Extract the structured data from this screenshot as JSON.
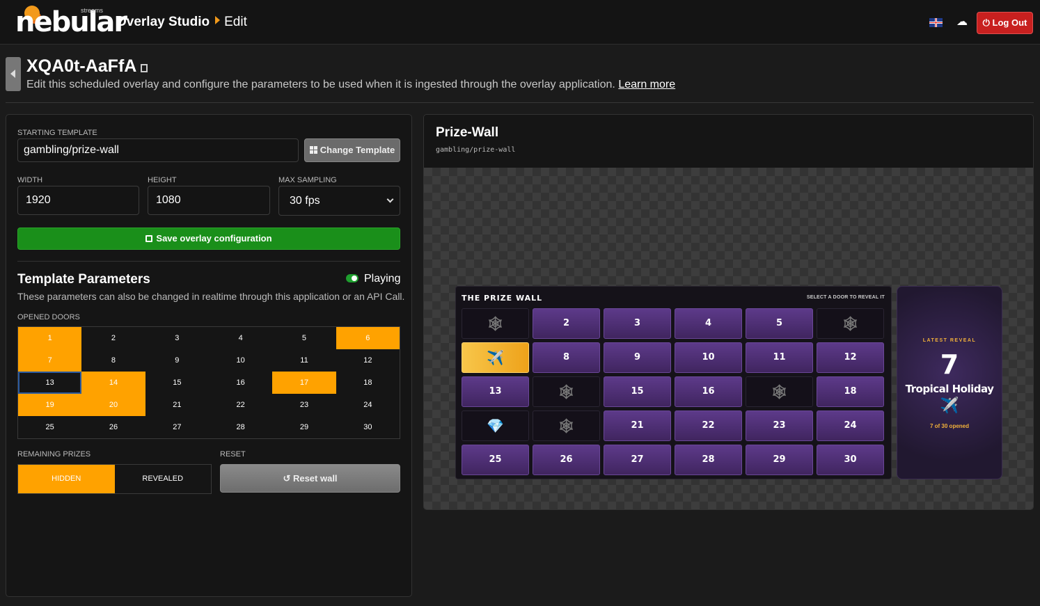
{
  "app": {
    "logo_text": "nebular",
    "logo_sub": "streams",
    "breadcrumb": [
      "Overlay Studio",
      "Edit"
    ],
    "language_flag": "uk-flag-icon",
    "logout_label": "Log Out",
    "colors": {
      "accent": "#f29a1b",
      "logout": "#c8201f",
      "save": "#1a8f1a",
      "door_open": "#ffa200"
    }
  },
  "header": {
    "overlay_id": "XQA0t-AaFfA",
    "description": "Edit this scheduled overlay and configure the parameters to be used when it is ingested through the overlay application.",
    "learn_more": "Learn more"
  },
  "config": {
    "template_label": "STARTING TEMPLATE",
    "template_value": "gambling/prize-wall",
    "change_template_label": "Change Template",
    "width_label": "WIDTH",
    "width_value": "1920",
    "height_label": "HEIGHT",
    "height_value": "1080",
    "sampling_label": "MAX SAMPLING",
    "sampling_value": "30 fps",
    "save_label": "Save overlay configuration"
  },
  "params": {
    "title": "Template Parameters",
    "playing_label": "Playing",
    "description": "These parameters can also be changed in realtime through this application or an API Call.",
    "doors_label": "OPENED DOORS",
    "doors": [
      "1",
      "2",
      "3",
      "4",
      "5",
      "6",
      "7",
      "8",
      "9",
      "10",
      "11",
      "12",
      "13",
      "14",
      "15",
      "16",
      "17",
      "18",
      "19",
      "20",
      "21",
      "22",
      "23",
      "24",
      "25",
      "26",
      "27",
      "28",
      "29",
      "30"
    ],
    "doors_opened": [
      1,
      6,
      7,
      14,
      17,
      19,
      20
    ],
    "remaining_label": "REMAINING PRIZES",
    "hidden_label": "HIDDEN",
    "revealed_label": "REVEALED",
    "reset_label": "RESET",
    "reset_button": "Reset wall"
  },
  "preview": {
    "title": "Prize-Wall",
    "template": "gambling/prize-wall",
    "wall_title": "THE PRIZE WALL",
    "wall_hint": "SELECT A DOOR TO REVEAL IT",
    "cells": [
      {
        "label": "",
        "state": "open",
        "icon": "🕸"
      },
      {
        "label": "2",
        "state": "closed"
      },
      {
        "label": "3",
        "state": "closed"
      },
      {
        "label": "4",
        "state": "closed"
      },
      {
        "label": "5",
        "state": "closed"
      },
      {
        "label": "",
        "state": "open",
        "icon": "🕸"
      },
      {
        "label": "",
        "state": "gold",
        "icon": "✈️"
      },
      {
        "label": "8",
        "state": "closed"
      },
      {
        "label": "9",
        "state": "closed"
      },
      {
        "label": "10",
        "state": "closed"
      },
      {
        "label": "11",
        "state": "closed"
      },
      {
        "label": "12",
        "state": "closed"
      },
      {
        "label": "13",
        "state": "closed"
      },
      {
        "label": "",
        "state": "open",
        "icon": "🕸"
      },
      {
        "label": "15",
        "state": "closed"
      },
      {
        "label": "16",
        "state": "closed"
      },
      {
        "label": "",
        "state": "open",
        "icon": "🕸"
      },
      {
        "label": "18",
        "state": "closed"
      },
      {
        "label": "",
        "state": "open",
        "icon": "💎"
      },
      {
        "label": "",
        "state": "open",
        "icon": "🕸"
      },
      {
        "label": "21",
        "state": "closed"
      },
      {
        "label": "22",
        "state": "closed"
      },
      {
        "label": "23",
        "state": "closed"
      },
      {
        "label": "24",
        "state": "closed"
      },
      {
        "label": "25",
        "state": "closed"
      },
      {
        "label": "26",
        "state": "closed"
      },
      {
        "label": "27",
        "state": "closed"
      },
      {
        "label": "28",
        "state": "closed"
      },
      {
        "label": "29",
        "state": "closed"
      },
      {
        "label": "30",
        "state": "closed"
      }
    ],
    "reveal": {
      "label": "LATEST REVEAL",
      "number": "7",
      "name": "Tropical Holiday",
      "icon": "✈️",
      "count": "7 of 30 opened"
    }
  }
}
